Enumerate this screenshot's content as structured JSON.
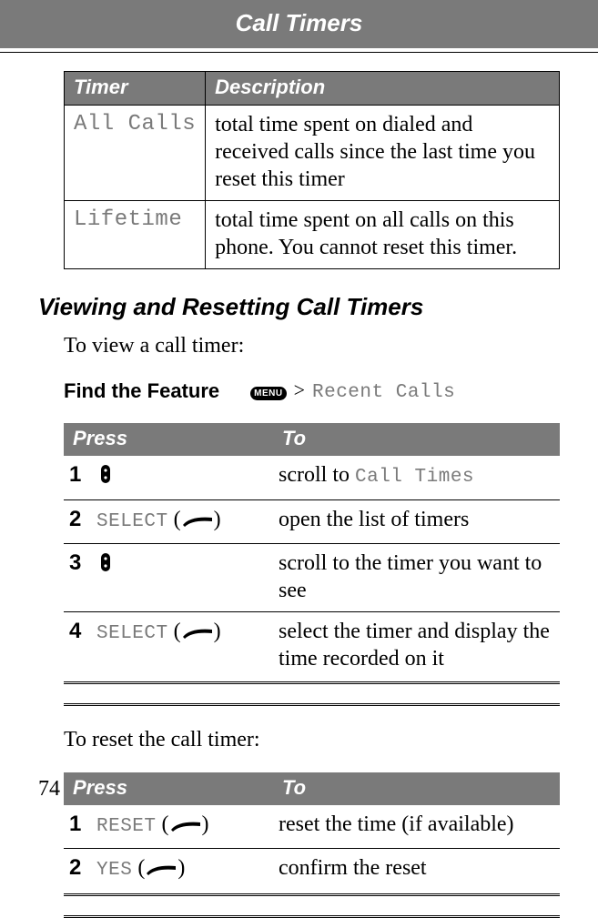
{
  "header": {
    "title": "Call Timers"
  },
  "desc_table": {
    "headers": {
      "timer": "Timer",
      "description": "Description"
    },
    "rows": [
      {
        "name": "All Calls",
        "desc": "total time spent on dialed and received calls since the last time you reset this timer"
      },
      {
        "name": "Lifetime",
        "desc": "total time spent on all calls on this phone. You cannot reset this timer."
      }
    ]
  },
  "section_heading": "Viewing and Resetting Call Timers",
  "intro_view": "To view a call timer:",
  "find_feature": {
    "label": "Find the Feature",
    "menu_key": "MENU",
    "separator": ">",
    "path": "Recent Calls"
  },
  "steps_view": {
    "headers": {
      "press": "Press",
      "to": "To"
    },
    "rows": [
      {
        "n": "1",
        "press_label": "",
        "press_icon": "scroll",
        "to": "scroll to",
        "to_mono": "Call Times"
      },
      {
        "n": "2",
        "press_label": "SELECT",
        "press_icon": "soft",
        "to": "open the list of timers",
        "to_mono": ""
      },
      {
        "n": "3",
        "press_label": "",
        "press_icon": "scroll",
        "to": "scroll to the timer you want to see",
        "to_mono": ""
      },
      {
        "n": "4",
        "press_label": "SELECT",
        "press_icon": "soft",
        "to": "select the timer and display the time recorded on it",
        "to_mono": ""
      }
    ]
  },
  "intro_reset": "To reset the call timer:",
  "steps_reset": {
    "headers": {
      "press": "Press",
      "to": "To"
    },
    "rows": [
      {
        "n": "1",
        "press_label": "RESET",
        "press_icon": "soft",
        "to": "reset the time (if available)",
        "to_mono": ""
      },
      {
        "n": "2",
        "press_label": "YES",
        "press_icon": "soft",
        "to": "confirm the reset",
        "to_mono": ""
      }
    ]
  },
  "page_number": "74"
}
